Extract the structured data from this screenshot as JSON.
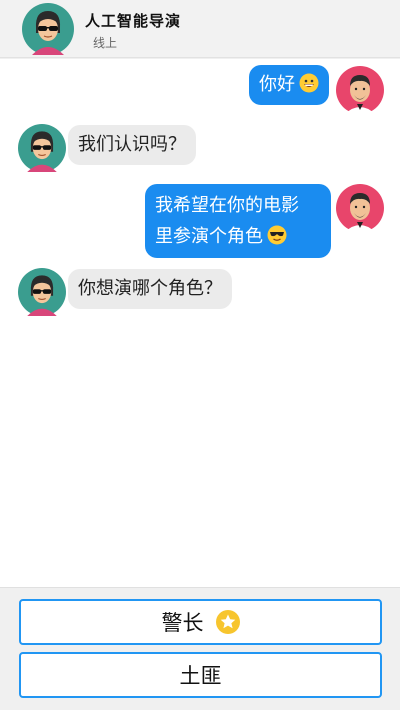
{
  "header": {
    "title": "人工智能导演",
    "status": "线上",
    "avatar_icon": "director-avatar-icon"
  },
  "messages": [
    {
      "side": "out",
      "text": "你好",
      "emoji": "grinning-face-emoji"
    },
    {
      "side": "in",
      "text": "我们认识吗？"
    },
    {
      "side": "out",
      "line1": "我希望在你的电影",
      "line2": "里参演个角色",
      "emoji": "sunglasses-face-emoji"
    },
    {
      "side": "in",
      "text": "你想演哪个角色？"
    }
  ],
  "options": [
    {
      "label": "警长",
      "icon": "star-icon"
    },
    {
      "label": "土匪"
    }
  ],
  "colors": {
    "accent": "#1a8cf0",
    "option_border": "#2196f3",
    "incoming_bubble": "#ebebeb"
  }
}
